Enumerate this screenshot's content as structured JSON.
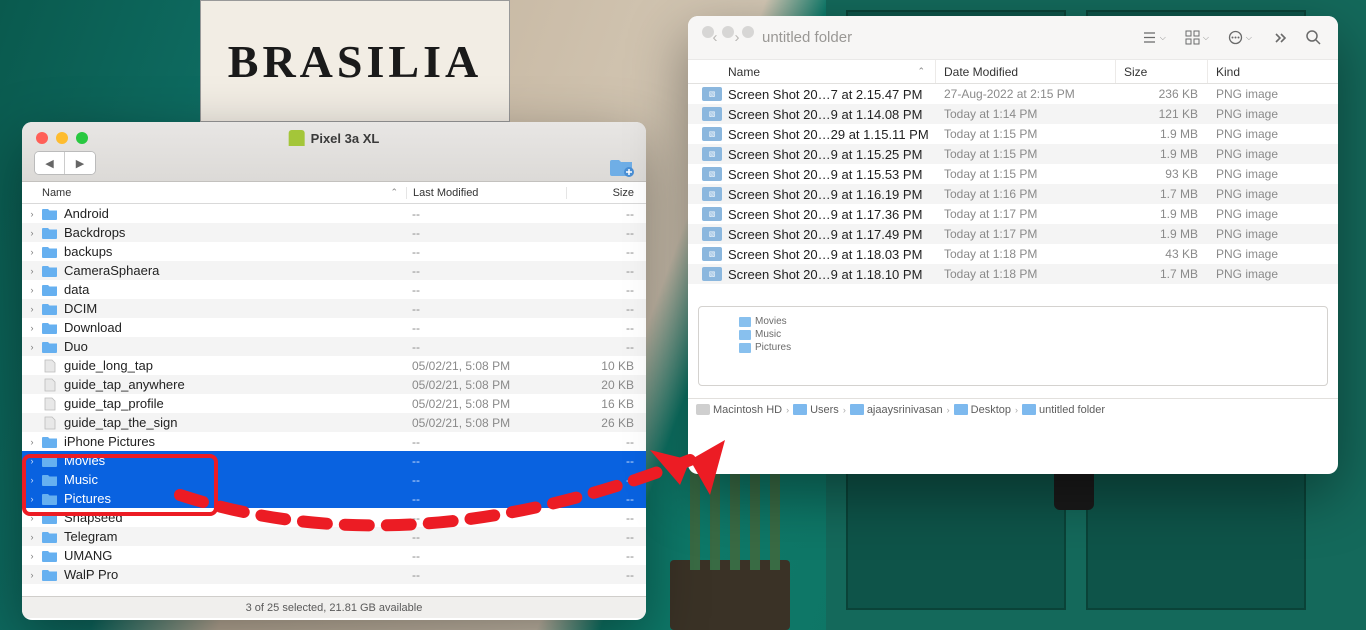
{
  "desktop": {
    "sign_text": "BRASILIA"
  },
  "left_window": {
    "title": "Pixel 3a XL",
    "columns": {
      "name": "Name",
      "modified": "Last Modified",
      "size": "Size"
    },
    "rows": [
      {
        "name": "Android",
        "type": "folder",
        "mod": "--",
        "size": "--",
        "exp": true
      },
      {
        "name": "Backdrops",
        "type": "folder",
        "mod": "--",
        "size": "--",
        "exp": true
      },
      {
        "name": "backups",
        "type": "folder",
        "mod": "--",
        "size": "--",
        "exp": true
      },
      {
        "name": "CameraSphaera",
        "type": "folder",
        "mod": "--",
        "size": "--",
        "exp": true
      },
      {
        "name": "data",
        "type": "folder",
        "mod": "--",
        "size": "--",
        "exp": true
      },
      {
        "name": "DCIM",
        "type": "folder",
        "mod": "--",
        "size": "--",
        "exp": true
      },
      {
        "name": "Download",
        "type": "folder",
        "mod": "--",
        "size": "--",
        "exp": true
      },
      {
        "name": "Duo",
        "type": "folder",
        "mod": "--",
        "size": "--",
        "exp": true
      },
      {
        "name": "guide_long_tap",
        "type": "file",
        "mod": "05/02/21, 5:08 PM",
        "size": "10 KB"
      },
      {
        "name": "guide_tap_anywhere",
        "type": "file",
        "mod": "05/02/21, 5:08 PM",
        "size": "20 KB"
      },
      {
        "name": "guide_tap_profile",
        "type": "file",
        "mod": "05/02/21, 5:08 PM",
        "size": "16 KB"
      },
      {
        "name": "guide_tap_the_sign",
        "type": "file",
        "mod": "05/02/21, 5:08 PM",
        "size": "26 KB"
      },
      {
        "name": "iPhone Pictures",
        "type": "folder",
        "mod": "--",
        "size": "--",
        "exp": true
      },
      {
        "name": "Movies",
        "type": "folder",
        "mod": "--",
        "size": "--",
        "exp": true,
        "sel": true
      },
      {
        "name": "Music",
        "type": "folder",
        "mod": "--",
        "size": "--",
        "exp": true,
        "sel": true
      },
      {
        "name": "Pictures",
        "type": "folder",
        "mod": "--",
        "size": "--",
        "exp": true,
        "sel": true
      },
      {
        "name": "Snapseed",
        "type": "folder",
        "mod": "--",
        "size": "--",
        "exp": true
      },
      {
        "name": "Telegram",
        "type": "folder",
        "mod": "--",
        "size": "--",
        "exp": true
      },
      {
        "name": "UMANG",
        "type": "folder",
        "mod": "--",
        "size": "--",
        "exp": true
      },
      {
        "name": "WalP Pro",
        "type": "folder",
        "mod": "--",
        "size": "--",
        "exp": true
      }
    ],
    "status": "3 of 25 selected, 21.81 GB available"
  },
  "right_window": {
    "title": "untitled folder",
    "columns": {
      "name": "Name",
      "modified": "Date Modified",
      "size": "Size",
      "kind": "Kind"
    },
    "files": [
      {
        "name": "Screen Shot 20…7 at 2.15.47 PM",
        "mod": "27-Aug-2022 at 2:15 PM",
        "size": "236 KB",
        "kind": "PNG image"
      },
      {
        "name": "Screen Shot 20…9 at 1.14.08 PM",
        "mod": "Today at 1:14 PM",
        "size": "121 KB",
        "kind": "PNG image"
      },
      {
        "name": "Screen Shot 20…29 at 1.15.11 PM",
        "mod": "Today at 1:15 PM",
        "size": "1.9 MB",
        "kind": "PNG image"
      },
      {
        "name": "Screen Shot 20…9 at 1.15.25 PM",
        "mod": "Today at 1:15 PM",
        "size": "1.9 MB",
        "kind": "PNG image"
      },
      {
        "name": "Screen Shot 20…9 at 1.15.53 PM",
        "mod": "Today at 1:15 PM",
        "size": "93 KB",
        "kind": "PNG image"
      },
      {
        "name": "Screen Shot 20…9 at 1.16.19 PM",
        "mod": "Today at 1:16 PM",
        "size": "1.7 MB",
        "kind": "PNG image"
      },
      {
        "name": "Screen Shot 20…9 at 1.17.36 PM",
        "mod": "Today at 1:17 PM",
        "size": "1.9 MB",
        "kind": "PNG image"
      },
      {
        "name": "Screen Shot 20…9 at 1.17.49 PM",
        "mod": "Today at 1:17 PM",
        "size": "1.9 MB",
        "kind": "PNG image"
      },
      {
        "name": "Screen Shot 20…9 at 1.18.03 PM",
        "mod": "Today at 1:18 PM",
        "size": "43 KB",
        "kind": "PNG image"
      },
      {
        "name": "Screen Shot 20…9 at 1.18.10 PM",
        "mod": "Today at 1:18 PM",
        "size": "1.7 MB",
        "kind": "PNG image"
      }
    ],
    "drop_items": [
      "Movies",
      "Music",
      "Pictures"
    ],
    "breadcrumb": [
      "Macintosh HD",
      "Users",
      "ajaaysrinivasan",
      "Desktop",
      "untitled folder"
    ]
  }
}
